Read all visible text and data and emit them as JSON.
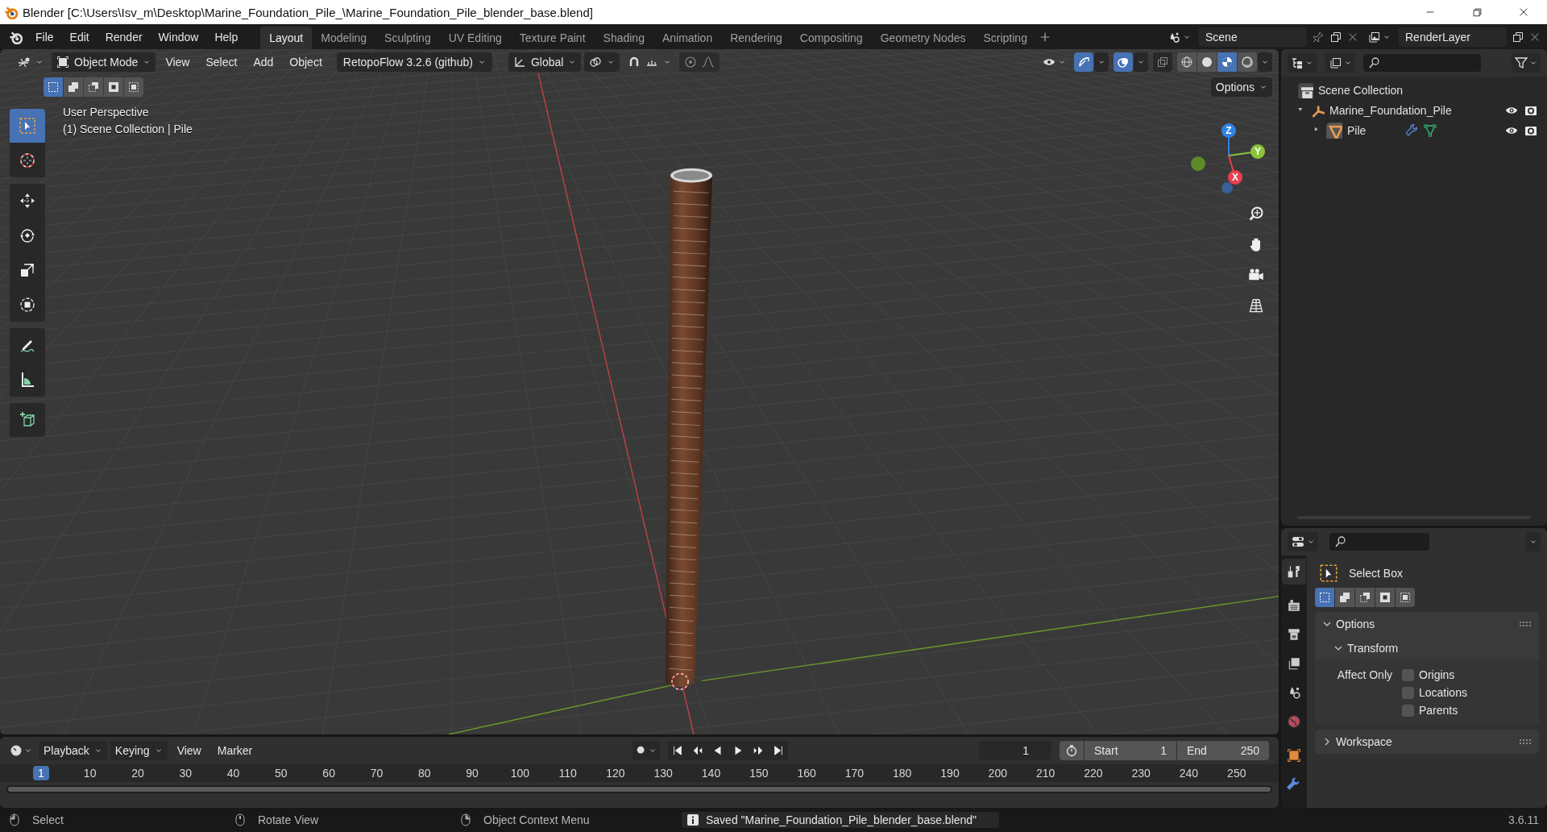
{
  "window": {
    "title": "Blender [C:\\Users\\Isv_m\\Desktop\\Marine_Foundation_Pile_\\Marine_Foundation_Pile_blender_base.blend]"
  },
  "menu": [
    "File",
    "Edit",
    "Render",
    "Window",
    "Help"
  ],
  "workspaces": [
    {
      "label": "Layout",
      "selected": true
    },
    {
      "label": "Modeling",
      "selected": false
    },
    {
      "label": "Sculpting",
      "selected": false
    },
    {
      "label": "UV Editing",
      "selected": false
    },
    {
      "label": "Texture Paint",
      "selected": false
    },
    {
      "label": "Shading",
      "selected": false
    },
    {
      "label": "Animation",
      "selected": false
    },
    {
      "label": "Rendering",
      "selected": false
    },
    {
      "label": "Compositing",
      "selected": false
    },
    {
      "label": "Geometry Nodes",
      "selected": false
    },
    {
      "label": "Scripting",
      "selected": false
    }
  ],
  "scene": "Scene",
  "view_layer": "RenderLayer",
  "viewport": {
    "mode": "Object Mode",
    "menus": [
      "View",
      "Select",
      "Add",
      "Object"
    ],
    "addon": "RetopoFlow 3.2.6 (github)",
    "orientation": "Global",
    "snap": {
      "on": false
    },
    "proportional_edit": {
      "on": false
    },
    "toggles": [
      {
        "kind": "gizmo",
        "on": true
      },
      {
        "kind": "overlay",
        "on": true
      },
      {
        "kind": "xray",
        "on": false
      }
    ],
    "shading": [
      {
        "kind": "wireframe",
        "selected": false
      },
      {
        "kind": "solid",
        "selected": false
      },
      {
        "kind": "material",
        "selected": true
      },
      {
        "kind": "rendered",
        "selected": false
      }
    ],
    "select_modes": [
      {
        "kind": "new",
        "selected": true
      },
      {
        "kind": "extend",
        "selected": false
      },
      {
        "kind": "subtract",
        "selected": false
      },
      {
        "kind": "invert",
        "selected": false
      },
      {
        "kind": "intersect",
        "selected": false
      }
    ],
    "options": "Options",
    "info": [
      "User Perspective",
      "(1) Scene Collection | Pile"
    ],
    "tools": [
      {
        "kind": "select-box",
        "selected": true
      },
      {
        "kind": "cursor",
        "selected": false
      },
      {
        "kind": "move",
        "selected": false
      },
      {
        "kind": "rotate",
        "selected": false
      },
      {
        "kind": "scale",
        "selected": false
      },
      {
        "kind": "transform",
        "selected": false
      },
      {
        "kind": "annotate",
        "selected": false
      },
      {
        "kind": "measure",
        "selected": false
      },
      {
        "kind": "add-cube",
        "selected": false
      }
    ],
    "axes": [
      "Z",
      "Y",
      "X"
    ]
  },
  "outliner": {
    "root": "Scene Collection",
    "items": [
      {
        "label": "Marine_Foundation_Pile",
        "kind": "collection",
        "expanded": true,
        "children": [
          {
            "label": "Pile",
            "kind": "mesh",
            "expanded": false
          }
        ]
      }
    ]
  },
  "properties": {
    "tabs": [
      {
        "kind": "tool",
        "selected": true
      },
      {
        "kind": "render",
        "selected": false
      },
      {
        "kind": "output",
        "selected": false
      },
      {
        "kind": "view-layer",
        "selected": false
      },
      {
        "kind": "scene",
        "selected": false
      },
      {
        "kind": "world",
        "selected": false
      },
      {
        "kind": "object",
        "selected": false
      },
      {
        "kind": "modifiers",
        "selected": false
      }
    ],
    "tool": "Select Box",
    "select_modes": [
      {
        "kind": "new",
        "selected": true
      },
      {
        "kind": "extend",
        "selected": false
      },
      {
        "kind": "subtract",
        "selected": false
      },
      {
        "kind": "invert",
        "selected": false
      },
      {
        "kind": "intersect",
        "selected": false
      }
    ],
    "panels": [
      {
        "label": "Options",
        "expanded": true,
        "subpanels": [
          {
            "label": "Transform",
            "expanded": true,
            "field_label": "Affect Only",
            "checkboxes": [
              {
                "label": "Origins",
                "checked": false
              },
              {
                "label": "Locations",
                "checked": false
              },
              {
                "label": "Parents",
                "checked": false
              }
            ]
          }
        ]
      },
      {
        "label": "Workspace",
        "expanded": false
      }
    ]
  },
  "timeline": {
    "menus": [
      "Playback",
      "Keying",
      "View",
      "Marker"
    ],
    "current_frame": "1",
    "start": {
      "label": "Start",
      "value": "1"
    },
    "end": {
      "label": "End",
      "value": "250"
    },
    "ruler": [
      {
        "label": "1",
        "selected": true
      },
      {
        "label": "10",
        "selected": false
      },
      {
        "label": "20",
        "selected": false
      },
      {
        "label": "30",
        "selected": false
      },
      {
        "label": "40",
        "selected": false
      },
      {
        "label": "50",
        "selected": false
      },
      {
        "label": "60",
        "selected": false
      },
      {
        "label": "70",
        "selected": false
      },
      {
        "label": "80",
        "selected": false
      },
      {
        "label": "90",
        "selected": false
      },
      {
        "label": "100",
        "selected": false
      },
      {
        "label": "110",
        "selected": false
      },
      {
        "label": "120",
        "selected": false
      },
      {
        "label": "130",
        "selected": false
      },
      {
        "label": "140",
        "selected": false
      },
      {
        "label": "150",
        "selected": false
      },
      {
        "label": "160",
        "selected": false
      },
      {
        "label": "170",
        "selected": false
      },
      {
        "label": "180",
        "selected": false
      },
      {
        "label": "190",
        "selected": false
      },
      {
        "label": "200",
        "selected": false
      },
      {
        "label": "210",
        "selected": false
      },
      {
        "label": "220",
        "selected": false
      },
      {
        "label": "230",
        "selected": false
      },
      {
        "label": "240",
        "selected": false
      },
      {
        "label": "250",
        "selected": false
      }
    ]
  },
  "status": {
    "hints": [
      {
        "kind": "left",
        "label": "Select"
      },
      {
        "kind": "middle",
        "label": "Rotate View"
      },
      {
        "kind": "right",
        "label": "Object Context Menu"
      }
    ],
    "message": "Saved \"Marine_Foundation_Pile_blender_base.blend\"",
    "version": "3.6.11"
  }
}
